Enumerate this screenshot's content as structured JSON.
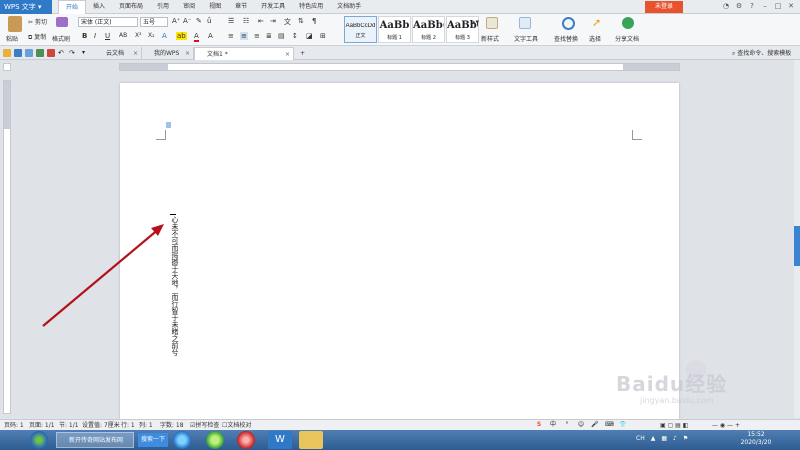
{
  "title_bar": {
    "app_name": "WPS 文字",
    "menu": [
      "开始",
      "插入",
      "页面布局",
      "引用",
      "审阅",
      "视图",
      "章节",
      "开发工具",
      "特色应用",
      "文档助手"
    ],
    "active_menu": "开始",
    "login_label": "未登录"
  },
  "ribbon": {
    "paste": "粘贴",
    "cut": "剪切",
    "copy": "复制",
    "format_painter": "格式刷",
    "font_name": "宋体 (正文)",
    "font_size": "五号",
    "styles": [
      {
        "sample": "AaBbCcDd",
        "label": "正文"
      },
      {
        "sample": "AaBb",
        "label": "标题 1"
      },
      {
        "sample": "AaBb(",
        "label": "标题 2"
      },
      {
        "sample": "AaBbC",
        "label": "标题 3"
      }
    ],
    "new_style": "新样式",
    "text_tools": "文字工具",
    "find_replace": "查找替换",
    "select": "选择",
    "share_doc": "分享文档"
  },
  "tabs": {
    "doc_tabs": [
      {
        "label": "云文档"
      },
      {
        "label": "我的WPS"
      },
      {
        "label": "文档1 *"
      }
    ],
    "add_tab": "+",
    "search_cmd": "查找命令、搜索模板"
  },
  "document": {
    "vertical_text": "心未不可而摇撼于天地，而行智于未睹之前兮"
  },
  "status": {
    "page_code": "页码: 1",
    "pages": "页面: 1/1",
    "section": "节: 1/1",
    "position": "设置值: 7厘米",
    "line": "行: 1",
    "col": "列: 1",
    "words": "字数: 18",
    "spell": "拼写检查",
    "doc_check": "文档校对"
  },
  "taskbar": {
    "ie_task": "新开传奇网站发布网",
    "search_btn": "搜索一下",
    "lang": "CH",
    "time": "15:52",
    "date": "2020/3/20"
  },
  "watermark": {
    "brand": "Baidu经验",
    "sub": "jingyan.baidu.com"
  },
  "colors": {
    "accent": "#2f79c7",
    "login": "#e8522e",
    "arrow": "#b3121b"
  }
}
